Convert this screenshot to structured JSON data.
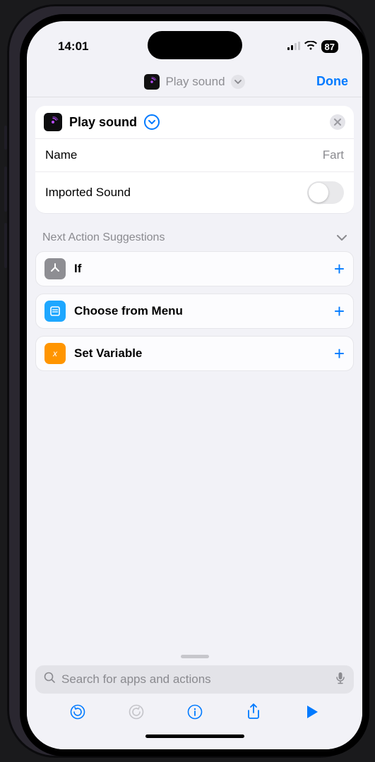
{
  "status": {
    "time": "14:01",
    "battery": "87"
  },
  "nav": {
    "title": "Play sound",
    "done": "Done"
  },
  "action_card": {
    "title": "Play sound",
    "rows": {
      "name_label": "Name",
      "name_value": "Fart",
      "imported_label": "Imported Sound",
      "imported_on": false
    }
  },
  "suggestions_header": "Next Action Suggestions",
  "suggestions": [
    {
      "label": "If",
      "icon": "branch-icon",
      "bg": "#8e8e93"
    },
    {
      "label": "Choose from Menu",
      "icon": "menu-icon",
      "bg": "#1ea7ff"
    },
    {
      "label": "Set Variable",
      "icon": "variable-icon",
      "bg": "#ff9500"
    }
  ],
  "search": {
    "placeholder": "Search for apps and actions"
  }
}
